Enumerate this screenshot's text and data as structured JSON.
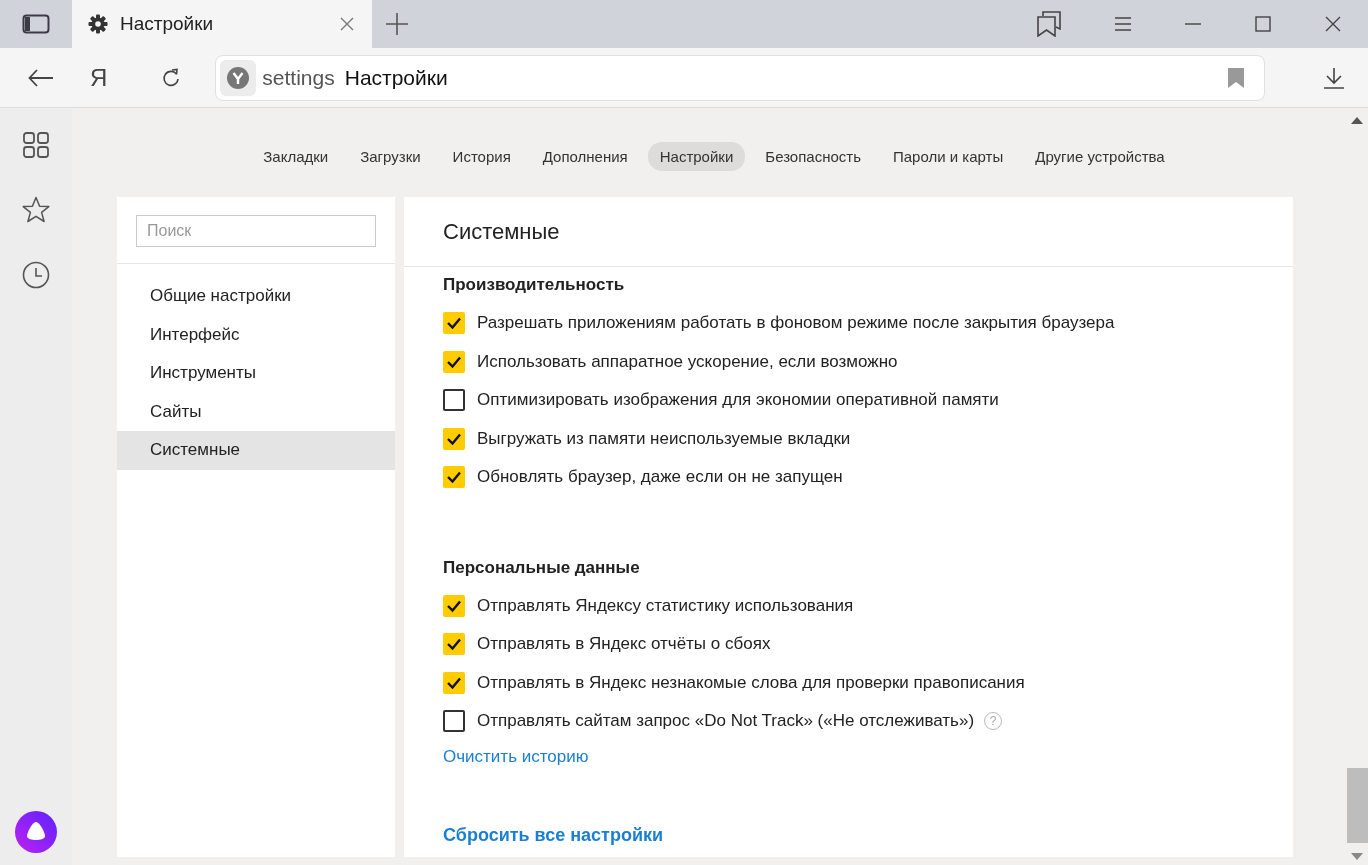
{
  "window": {
    "tab_title": "Настройки"
  },
  "toolbar": {
    "yandex_button": "Я",
    "address": {
      "scheme": "settings",
      "title": "Настройки"
    }
  },
  "nav": [
    {
      "label": "Закладки",
      "selected": false
    },
    {
      "label": "Загрузки",
      "selected": false
    },
    {
      "label": "История",
      "selected": false
    },
    {
      "label": "Дополнения",
      "selected": false
    },
    {
      "label": "Настройки",
      "selected": true
    },
    {
      "label": "Безопасность",
      "selected": false
    },
    {
      "label": "Пароли и карты",
      "selected": false
    },
    {
      "label": "Другие устройства",
      "selected": false
    }
  ],
  "sidebar": {
    "search": {
      "placeholder": "Поиск"
    },
    "items": [
      {
        "label": "Общие настройки",
        "selected": false
      },
      {
        "label": "Интерфейс",
        "selected": false
      },
      {
        "label": "Инструменты",
        "selected": false
      },
      {
        "label": "Сайты",
        "selected": false
      },
      {
        "label": "Системные",
        "selected": true
      }
    ]
  },
  "content": {
    "title": "Системные",
    "groups": [
      {
        "title": "Производительность",
        "options": [
          {
            "label": "Разрешать приложениям работать в фоновом режиме после закрытия браузера",
            "checked": true
          },
          {
            "label": "Использовать аппаратное ускорение, если возможно",
            "checked": true
          },
          {
            "label": "Оптимизировать изображения для экономии оперативной памяти",
            "checked": false
          },
          {
            "label": "Выгружать из памяти неиспользуемые вкладки",
            "checked": true
          },
          {
            "label": "Обновлять браузер, даже если он не запущен",
            "checked": true
          }
        ]
      },
      {
        "title": "Персональные данные",
        "options": [
          {
            "label": "Отправлять Яндексу статистику использования",
            "checked": true
          },
          {
            "label": "Отправлять в Яндекс отчёты о сбоях",
            "checked": true
          },
          {
            "label": "Отправлять в Яндекс незнакомые слова для проверки правописания",
            "checked": true
          },
          {
            "label": "Отправлять сайтам запрос «Do Not Track» («Не отслеживать»)",
            "checked": false,
            "help": "?"
          }
        ],
        "link": "Очистить историю"
      }
    ],
    "reset_link": "Сбросить все настройки"
  }
}
